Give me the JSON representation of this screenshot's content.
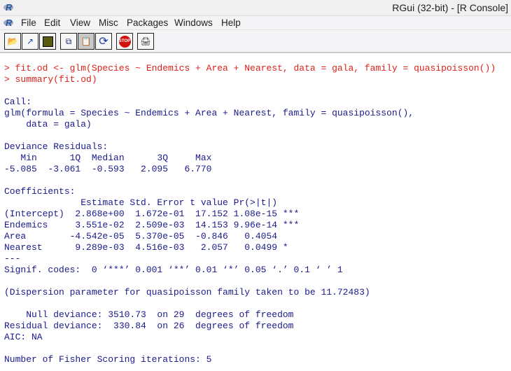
{
  "window": {
    "title": "RGui (32-bit) - [R Console]"
  },
  "menu": [
    "File",
    "Edit",
    "View",
    "Misc",
    "Packages",
    "Windows",
    "Help"
  ],
  "toolbar": [
    {
      "name": "open-script",
      "icon": "folder-open-icon"
    },
    {
      "name": "load-workspace",
      "icon": "load-workspace-icon"
    },
    {
      "name": "save-workspace",
      "icon": "save-icon"
    },
    {
      "name": "copy",
      "icon": "copy-icon"
    },
    {
      "name": "paste",
      "icon": "paste-icon"
    },
    {
      "name": "copy-paste",
      "icon": "refresh-icon"
    },
    {
      "name": "stop",
      "icon": "stop-icon",
      "label": "STOP"
    },
    {
      "name": "print",
      "icon": "print-icon"
    }
  ],
  "console": [
    {
      "type": "cmd",
      "text": "> fit.od <- glm(Species ~ Endemics + Area + Nearest, data = gala, family = quasipoisson())"
    },
    {
      "type": "cmd",
      "text": "> summary(fit.od)"
    },
    {
      "type": "out",
      "text": ""
    },
    {
      "type": "out",
      "text": "Call:"
    },
    {
      "type": "out",
      "text": "glm(formula = Species ~ Endemics + Area + Nearest, family = quasipoisson(),"
    },
    {
      "type": "out",
      "text": "    data = gala)"
    },
    {
      "type": "out",
      "text": ""
    },
    {
      "type": "out",
      "text": "Deviance Residuals: "
    },
    {
      "type": "out",
      "text": "   Min      1Q  Median      3Q     Max  "
    },
    {
      "type": "out",
      "text": "-5.085  -3.061  -0.593   2.095   6.770  "
    },
    {
      "type": "out",
      "text": ""
    },
    {
      "type": "out",
      "text": "Coefficients:"
    },
    {
      "type": "out",
      "text": "              Estimate Std. Error t value Pr(>|t|)    "
    },
    {
      "type": "out",
      "text": "(Intercept)  2.868e+00  1.672e-01  17.152 1.08e-15 ***"
    },
    {
      "type": "out",
      "text": "Endemics     3.551e-02  2.509e-03  14.153 9.96e-14 ***"
    },
    {
      "type": "out",
      "text": "Area        -4.542e-05  5.370e-05  -0.846   0.4054    "
    },
    {
      "type": "out",
      "text": "Nearest      9.289e-03  4.516e-03   2.057   0.0499 *  "
    },
    {
      "type": "out",
      "text": "---"
    },
    {
      "type": "out",
      "text": "Signif. codes:  0 ‘***’ 0.001 ‘**’ 0.01 ‘*’ 0.05 ‘.’ 0.1 ‘ ’ 1"
    },
    {
      "type": "out",
      "text": ""
    },
    {
      "type": "out",
      "text": "(Dispersion parameter for quasipoisson family taken to be 11.72483)"
    },
    {
      "type": "out",
      "text": ""
    },
    {
      "type": "out",
      "text": "    Null deviance: 3510.73  on 29  degrees of freedom"
    },
    {
      "type": "out",
      "text": "Residual deviance:  330.84  on 26  degrees of freedom"
    },
    {
      "type": "out",
      "text": "AIC: NA"
    },
    {
      "type": "out",
      "text": ""
    },
    {
      "type": "out",
      "text": "Number of Fisher Scoring iterations: 5"
    }
  ]
}
